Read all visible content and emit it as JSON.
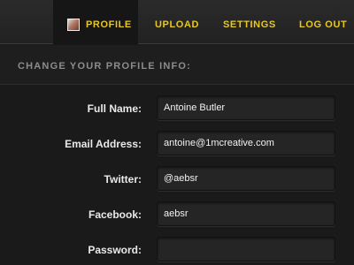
{
  "nav": {
    "items": [
      {
        "label": "PROFILE"
      },
      {
        "label": "UPLOAD"
      },
      {
        "label": "SETTINGS"
      },
      {
        "label": "LOG OUT"
      }
    ],
    "active": "PROFILE",
    "accent": "#e8c81f"
  },
  "section": {
    "title": "CHANGE YOUR PROFILE INFO:"
  },
  "form": {
    "full_name": {
      "label": "Full Name:",
      "value": "Antoine Butler"
    },
    "email": {
      "label": "Email Address:",
      "value": "antoine@1mcreative.com"
    },
    "twitter": {
      "label": "Twitter:",
      "value": "@aebsr"
    },
    "facebook": {
      "label": "Facebook:",
      "value": "aebsr"
    },
    "password": {
      "label": "Password:",
      "value": ""
    }
  }
}
